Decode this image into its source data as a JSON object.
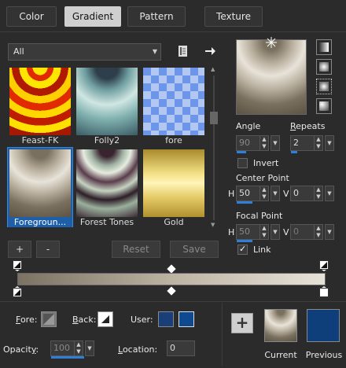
{
  "tabs": [
    {
      "label": "Color"
    },
    {
      "label": "Gradient"
    },
    {
      "label": "Pattern"
    },
    {
      "label": "Texture"
    }
  ],
  "library": {
    "filter_value": "All",
    "items": [
      {
        "label": "Feast-FK"
      },
      {
        "label": "Folly2"
      },
      {
        "label": "fore"
      },
      {
        "label": "Foregroun..."
      },
      {
        "label": "Forest Tones"
      },
      {
        "label": "Gold"
      }
    ],
    "buttons": {
      "add": "+",
      "remove": "-",
      "reset": "Reset",
      "save": "Save"
    }
  },
  "properties": {
    "angle_label": "Angle",
    "angle_value": "90",
    "repeats_label": "Repeats",
    "repeats_value": "2",
    "invert_label": "Invert",
    "invert_checked": false,
    "center_point_label": "Center Point",
    "center_h_label": "H",
    "center_h_value": "50",
    "center_v_label": "V",
    "center_v_value": "0",
    "focal_point_label": "Focal Point",
    "focal_h_label": "H",
    "focal_h_value": "50",
    "focal_v_label": "V",
    "focal_v_value": "0",
    "link_label": "Link",
    "link_checked": true
  },
  "bottom": {
    "fore_label": "Fore:",
    "back_label": "Back:",
    "user_label": "User:",
    "opacity_label": "Opacity:",
    "opacity_value": "100",
    "location_label": "Location:",
    "location_value": "0",
    "add_button": "+",
    "current_label": "Current",
    "previous_label": "Previous"
  },
  "colors": {
    "accent": "#2f7fd8",
    "selection": "#1d5fa8",
    "user_color_1": "#1a3f78",
    "user_color_2": "#0f4a90",
    "previous_color": "#0e3f7a",
    "gradient_start": "#7b7263",
    "gradient_end": "#e7e2d8"
  },
  "icons": {
    "library_menu": "book-menu-icon",
    "library_arrow": "right-arrow-icon",
    "style_linear": "linear-style-icon",
    "style_rectangular": "rectangular-style-icon",
    "style_sunburst": "sunburst-style-icon",
    "style_radial": "radial-style-icon"
  }
}
